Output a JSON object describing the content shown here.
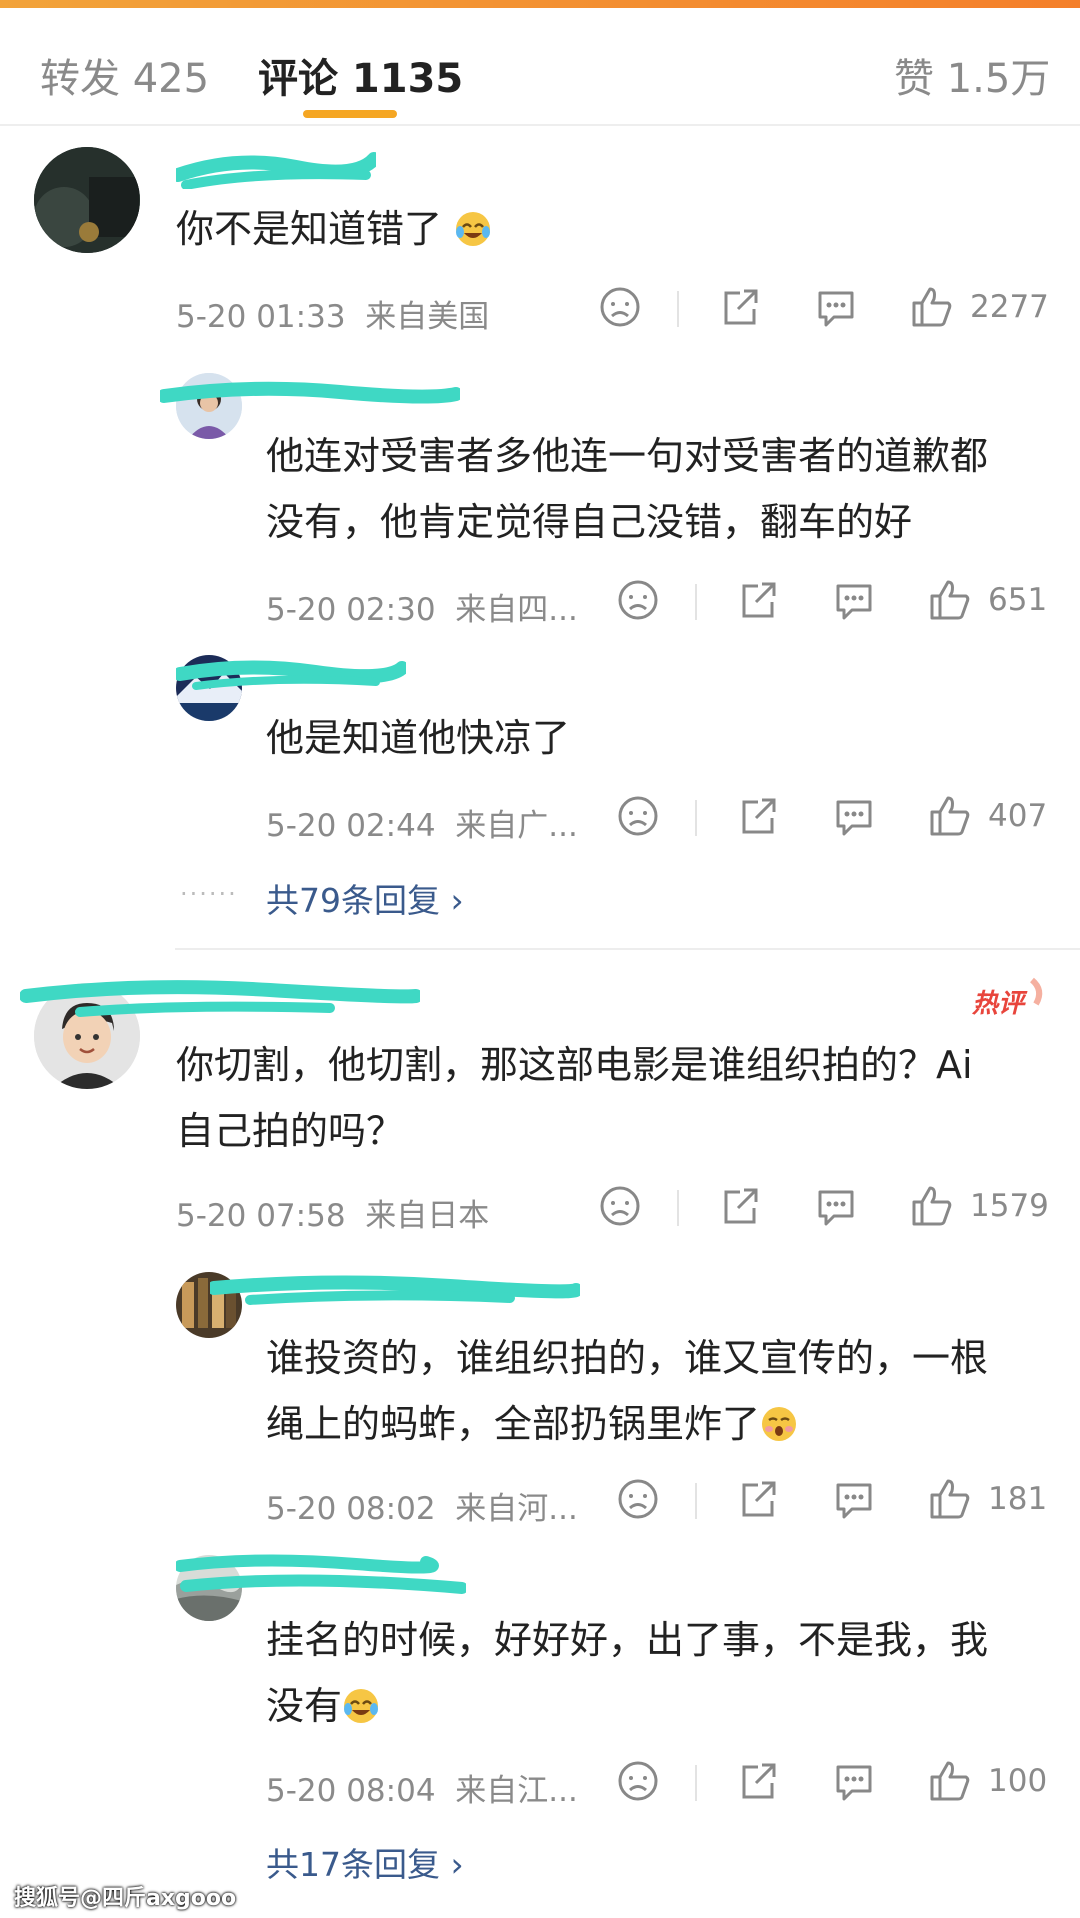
{
  "tabs": {
    "repost": "转发 425",
    "comments": "评论 1135",
    "likes": "赞 1.5万"
  },
  "comments": [
    {
      "text": "你不是知道错了",
      "time": "5-20 01:33",
      "location": "来自美国",
      "likes": "2277",
      "replies": [
        {
          "text_line1": "他连对受害者多他连一句对受害者的道歉都",
          "text_line2": "没有，他肯定觉得自己没错，翻车的好",
          "time": "5-20 02:30",
          "location": "来自四...",
          "likes": "651"
        },
        {
          "text_line1": "他是知道他快凉了",
          "time": "5-20 02:44",
          "location": "来自广...",
          "likes": "407"
        }
      ],
      "more": "共79条回复 ›"
    },
    {
      "hot_badge": "热评",
      "text_line1": "你切割，他切割，那这部电影是谁组织拍的？Ai",
      "text_line2": "自己拍的吗？",
      "time": "5-20 07:58",
      "location": "来自日本",
      "likes": "1579",
      "replies": [
        {
          "text_line1": "谁投资的，谁组织拍的，谁又宣传的，一根",
          "text_line2": "绳上的蚂蚱，全部扔锅里炸了",
          "time": "5-20 08:02",
          "location": "来自河...",
          "likes": "181"
        },
        {
          "text_line1": "挂名的时候，好好好，出了事，不是我，我",
          "text_line2": "没有",
          "time": "5-20 08:04",
          "location": "来自江...",
          "likes": "100"
        }
      ],
      "more": "共17条回复 ›"
    }
  ],
  "watermark": "搜狐号@四斤axgooo",
  "colors": {
    "accent": "#f5a623",
    "scribble": "#3fd8c4",
    "link": "#3a5a8c",
    "hot": "#e8453c"
  }
}
